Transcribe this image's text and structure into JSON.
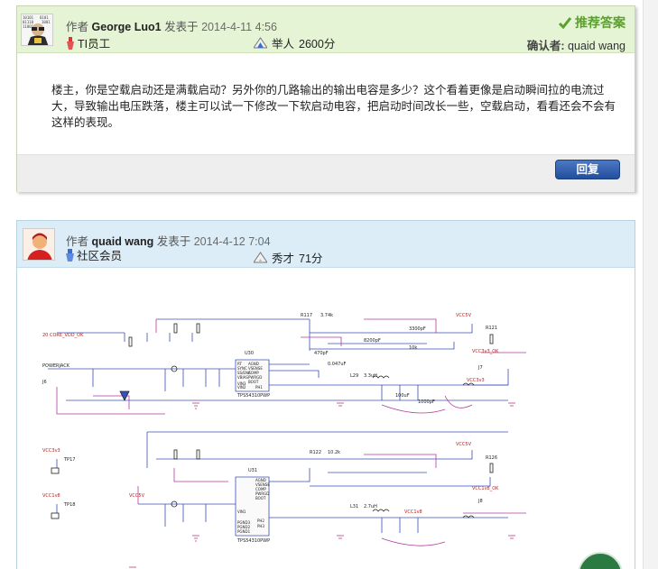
{
  "post1": {
    "author_prefix": "作者",
    "author": "George Luo1",
    "posted_prefix": "发表于",
    "date": "2014-4-11 4:56",
    "role": "TI员工",
    "rank": "举人",
    "points": "2600分",
    "best_answer": "推荐答案",
    "confirm_label": "确认者:",
    "confirmer": "quaid wang",
    "body": "楼主，你是空载启动还是满载启动？另外你的几路输出的输出电容是多少？这个看着更像是启动瞬间拉的电流过大，导致输出电压跌落，楼主可以试一下修改一下软启动电容，把启动时间改长一些，空载启动，看看还会不会有这样的表现。",
    "reply_label": "回复"
  },
  "post2": {
    "author_prefix": "作者",
    "author": "quaid wang",
    "posted_prefix": "发表于",
    "date": "2014-4-12 7:04",
    "role": "社区会员",
    "rank": "秀才",
    "points": "71分"
  },
  "schematic": {
    "net_core": "20  CORE_VDD_OK",
    "vcc5v": "VCC5V",
    "vcc3v3": "VCC3v3",
    "vcc1v8": "VCC1v8",
    "u30": "U30",
    "u31": "U31",
    "chip": "TPS54310PWP",
    "powerjack": "POWERJACK",
    "j6": "J6",
    "j7": "J7",
    "j8": "J8",
    "tp17": "TP17",
    "tp18": "TP18",
    "vcc33_ok": "VCC3v3_OK",
    "vcc18_ok": "VCC1v8_OK",
    "l29": "L29",
    "l31": "L31",
    "l29_val": "3.3uH",
    "l31_val": "2.7uH",
    "r117": "R117",
    "r122": "R122",
    "r117_val": "3.74k",
    "r122_val": "10.2k",
    "cap1": "3300pF",
    "cap2": "8200pF",
    "cap3": "470pF",
    "cap4": "0.047uF",
    "cap5": "100uF",
    "cap6": "1000pF",
    "r10k": "10k",
    "r121": "R121",
    "r126": "R126",
    "pins": [
      "AGND",
      "VSENSE",
      "COMP",
      "PWRGD",
      "BOOT",
      "RT",
      "SYNC",
      "SS/ENA",
      "VBIAS",
      "VIN3",
      "VIN2",
      "VIN1",
      "PGND3",
      "PGND2",
      "PGND1",
      "PH1",
      "PH2",
      "PH3"
    ]
  },
  "colors": {
    "header1_bg": "#e5f4d5",
    "header2_bg": "#dcedf7",
    "best_answer": "#5aa12b",
    "reply_button": "#2a5aa8",
    "wire_blue": "#3b4fb8",
    "wire_magenta": "#b23aa0"
  },
  "icons": [
    "ti-employee-icon",
    "community-member-icon",
    "rank-icon",
    "check-icon",
    "avatar"
  ]
}
